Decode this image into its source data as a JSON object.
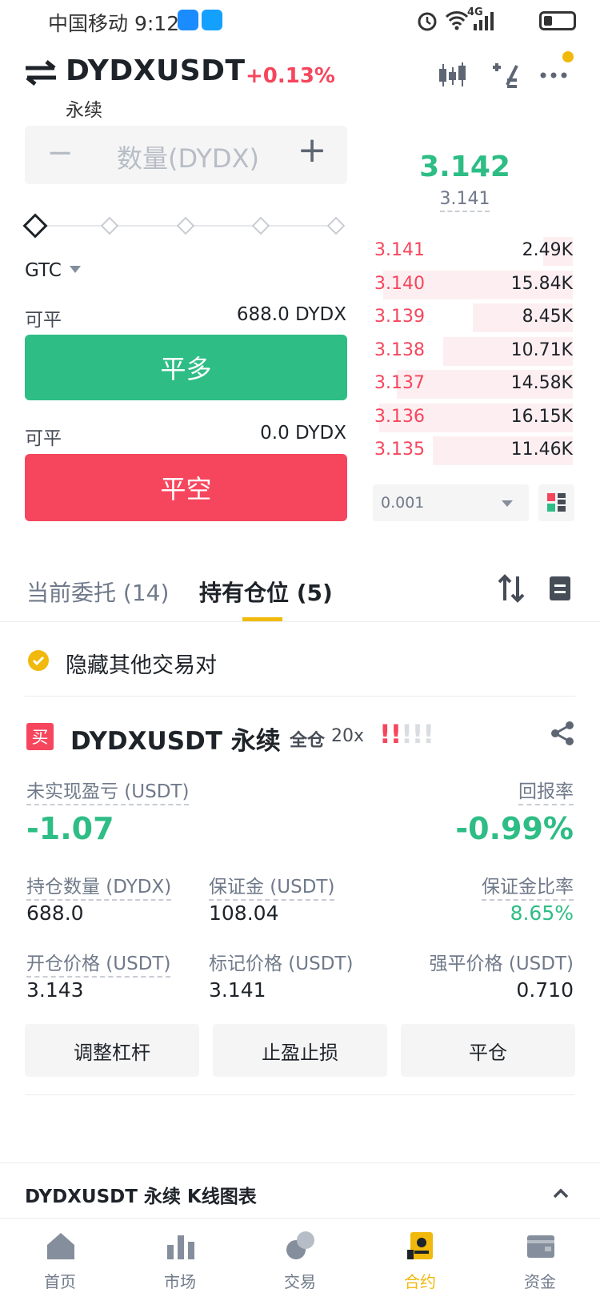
{
  "status_bar": {
    "carrier": "中国移动",
    "time": "9:12",
    "network": "4G"
  },
  "header": {
    "symbol": "DYDXUSDT",
    "change": "+0.13%",
    "contract_type": "永续"
  },
  "order_form": {
    "qty_placeholder": "数量(DYDX)",
    "minus": "−",
    "plus": "+",
    "tif": "GTC",
    "close_long": {
      "label": "可平",
      "value": "688.0 DYDX",
      "button": "平多"
    },
    "close_short": {
      "label": "可平",
      "value": "0.0 DYDX",
      "button": "平空"
    }
  },
  "order_book": {
    "last_price": "3.142",
    "mark_price": "3.141",
    "asks": [
      {
        "price": "3.141",
        "qty": "2.49K",
        "depth": 0.15
      },
      {
        "price": "3.140",
        "qty": "15.84K",
        "depth": 0.95
      },
      {
        "price": "3.139",
        "qty": "8.45K",
        "depth": 0.5
      },
      {
        "price": "3.138",
        "qty": "10.71K",
        "depth": 0.65
      },
      {
        "price": "3.137",
        "qty": "14.58K",
        "depth": 0.88
      },
      {
        "price": "3.136",
        "qty": "16.15K",
        "depth": 0.97
      },
      {
        "price": "3.135",
        "qty": "11.46K",
        "depth": 0.7
      }
    ],
    "precision": "0.001"
  },
  "tabs": {
    "open_orders": "当前委托 (14)",
    "positions": "持有仓位 (5)"
  },
  "hide_other_pairs": "隐藏其他交易对",
  "position": {
    "side_badge": "买",
    "symbol": "DYDXUSDT 永续",
    "margin_mode": "全仓",
    "leverage": "20x",
    "unrealized_pnl_label": "未实现盈亏 (USDT)",
    "unrealized_pnl": "-1.07",
    "roe_label": "回报率",
    "roe": "-0.99%",
    "size_label": "持仓数量 (DYDX)",
    "size": "688.0",
    "margin_label": "保证金 (USDT)",
    "margin": "108.04",
    "margin_ratio_label": "保证金比率",
    "margin_ratio": "8.65%",
    "entry_label": "开仓价格 (USDT)",
    "entry": "3.143",
    "mark_label": "标记价格 (USDT)",
    "mark": "3.141",
    "liq_label": "强平价格 (USDT)",
    "liq": "0.710",
    "buttons": {
      "leverage": "调整杠杆",
      "tpsl": "止盈止损",
      "close": "平仓"
    }
  },
  "kline_bar": "DYDXUSDT 永续  K线图表",
  "bottom_nav": [
    {
      "label": "首页",
      "icon": "home-icon"
    },
    {
      "label": "市场",
      "icon": "market-icon"
    },
    {
      "label": "交易",
      "icon": "trade-icon"
    },
    {
      "label": "合约",
      "icon": "futures-icon",
      "active": true
    },
    {
      "label": "资金",
      "icon": "wallet-icon"
    }
  ],
  "colors": {
    "green": "#2ebd85",
    "red": "#f6465d",
    "accent": "#f0b90b"
  }
}
